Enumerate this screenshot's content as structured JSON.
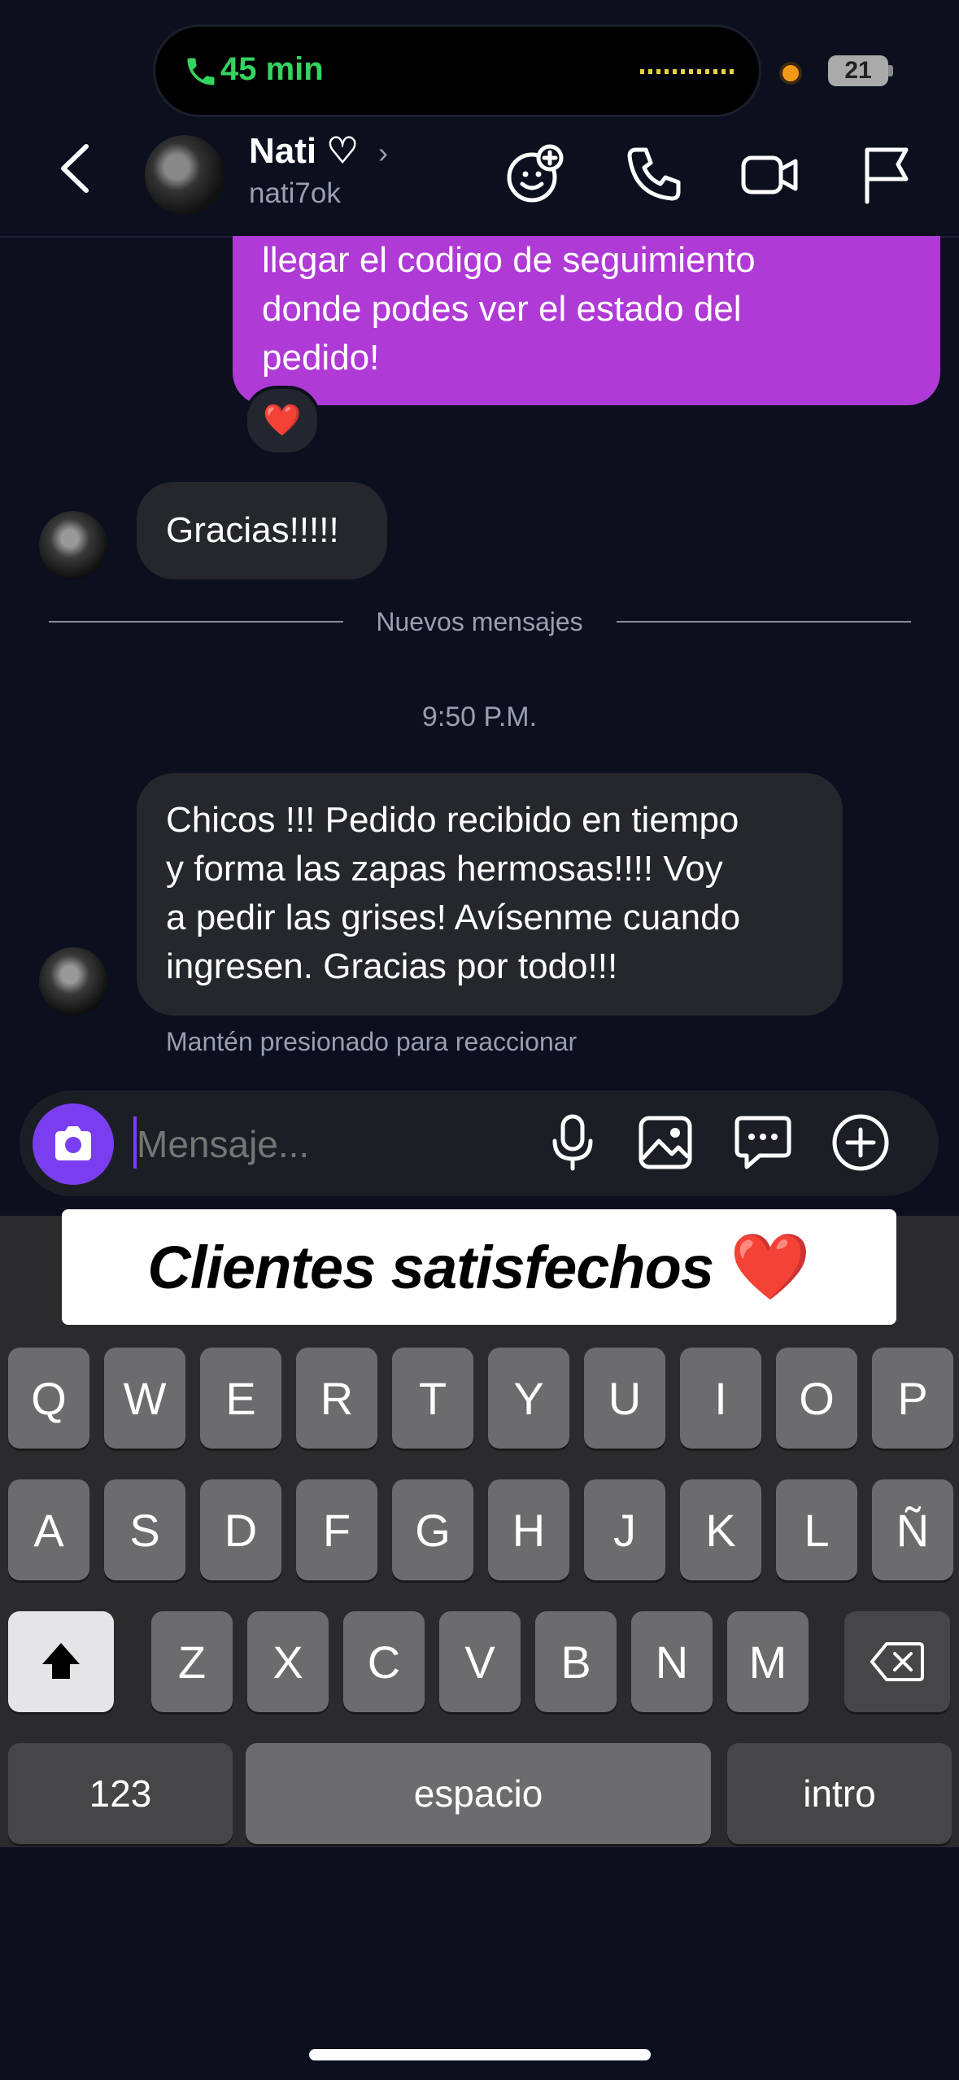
{
  "status": {
    "call_timer": "45 min",
    "battery": "21"
  },
  "header": {
    "name": "Nati ♡",
    "chevron": "›",
    "username": "nati7ok"
  },
  "messages": {
    "outgoing_lines": [
      "llegar el codigo de seguimiento",
      "donde podes ver el estado del",
      "pedido!"
    ],
    "reaction": "❤️",
    "incoming1": "Gracias!!!!!",
    "new_messages_label": "Nuevos mensajes",
    "timestamp": "9:50 P.M.",
    "incoming2_lines": [
      "Chicos !!! Pedido recibido en tiempo",
      "y forma las zapas hermosas!!!! Voy",
      "a pedir las grises! Avísenme cuando",
      "ingresen. Gracias por todo!!!"
    ],
    "hint": "Mantén presionado para reaccionar"
  },
  "composer": {
    "placeholder": "Mensaje..."
  },
  "overlay": {
    "text": "Clientes satisfechos",
    "emoji": "❤️"
  },
  "keyboard": {
    "row1": [
      "Q",
      "W",
      "E",
      "R",
      "T",
      "Y",
      "U",
      "I",
      "O",
      "P"
    ],
    "row2": [
      "A",
      "S",
      "D",
      "F",
      "G",
      "H",
      "J",
      "K",
      "L",
      "Ñ"
    ],
    "row3": [
      "Z",
      "X",
      "C",
      "V",
      "B",
      "N",
      "M"
    ],
    "numbers": "123",
    "space": "espacio",
    "return": "intro"
  }
}
